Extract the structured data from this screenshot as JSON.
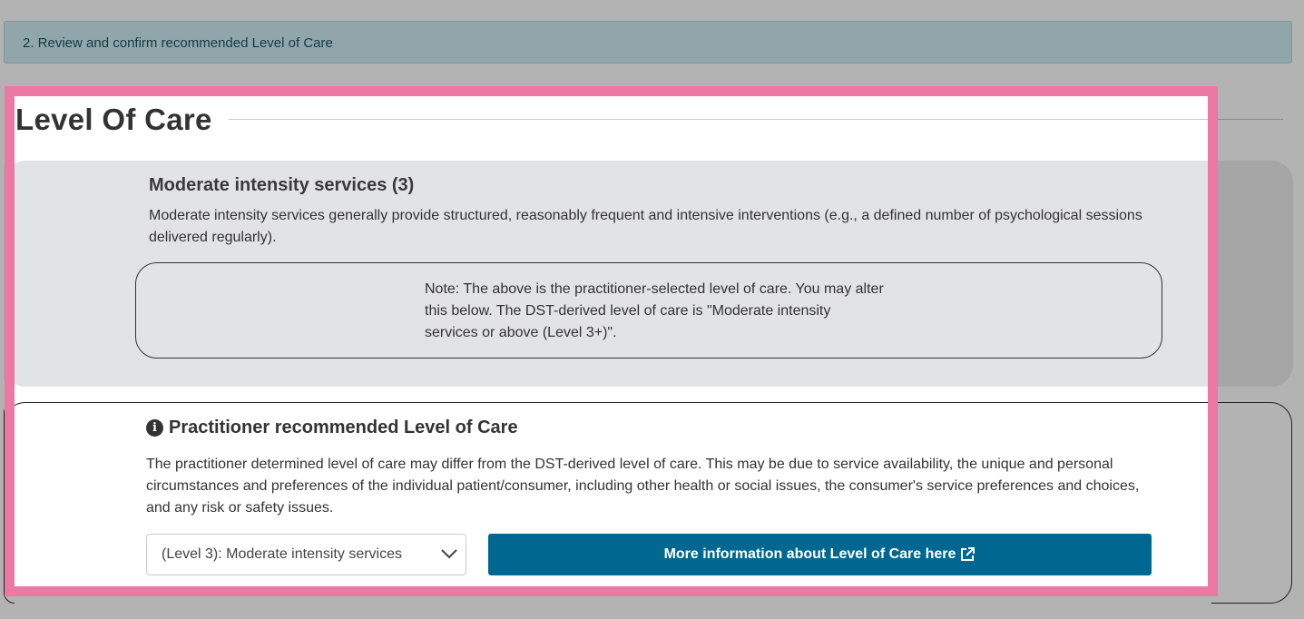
{
  "step_banner": {
    "label": "2. Review and confirm recommended Level of Care"
  },
  "level_of_care": {
    "title": "Level Of Care",
    "selected": {
      "heading": "Moderate intensity services (3)",
      "description": "Moderate intensity services generally provide structured, reasonably frequent and intensive interventions (e.g., a defined number of psychological sessions delivered regularly).",
      "note": "Note: The above is the practitioner-selected level of care. You may alter this below. The DST-derived level of care is \"Moderate intensity services or above (Level 3+)\"."
    },
    "recommended": {
      "heading": "Practitioner recommended Level of Care",
      "description": "The practitioner determined level of care may differ from the DST-derived level of care. This may be due to service availability, the unique and personal circumstances and preferences of the individual patient/consumer, including other health or social issues, the consumer's service preferences and choices, and any risk or safety issues.",
      "select_value": "(Level 3): Moderate intensity services",
      "info_button_label": "More information about Level of Care here"
    }
  },
  "icons": {
    "info": "info-circle-icon",
    "chevron": "chevron-down-icon",
    "external": "external-link-icon"
  },
  "colors": {
    "highlight_border": "#ec79a3",
    "primary_button": "#006890",
    "banner_bg": "#91a6aa",
    "overlay": "#b3b3b3"
  }
}
